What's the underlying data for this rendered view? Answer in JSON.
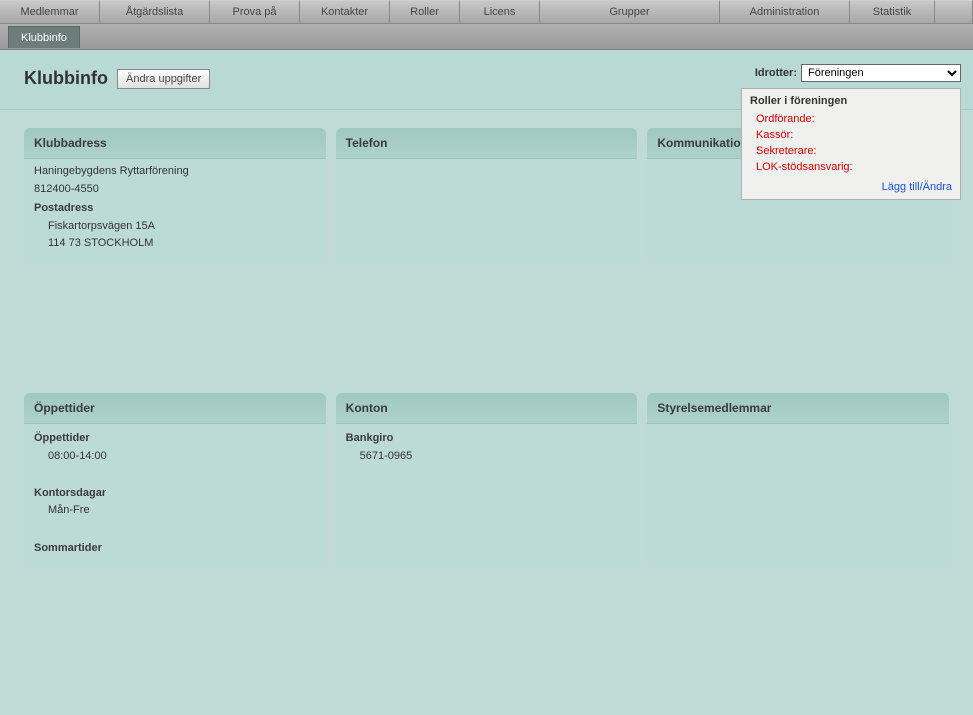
{
  "topnav": [
    {
      "label": "Medlemmar",
      "w": 100
    },
    {
      "label": "Åtgärdslista",
      "w": 110
    },
    {
      "label": "Prova på",
      "w": 90
    },
    {
      "label": "Kontakter",
      "w": 90
    },
    {
      "label": "Roller",
      "w": 70
    },
    {
      "label": "Licens",
      "w": 80
    },
    {
      "label": "Grupper",
      "w": 180
    },
    {
      "label": "Administration",
      "w": 130
    },
    {
      "label": "Statistik",
      "w": 85
    }
  ],
  "subnav": {
    "active": "Klubbinfo"
  },
  "page": {
    "title": "Klubbinfo",
    "edit_label": "Ändra uppgifter"
  },
  "idrotter": {
    "label": "Idrotter:",
    "selected": "Föreningen"
  },
  "roles": {
    "title": "Roller i föreningen",
    "items": [
      "Ordförande:",
      "Kassör:",
      "Sekreterare:",
      "LOK-stödsansvarig:"
    ],
    "link": "Lägg till/Ändra"
  },
  "cards": {
    "klubbadress": {
      "title": "Klubbadress",
      "name": "Haningebygdens Ryttarförening",
      "orgnr": "812400-4550",
      "post_label": "Postadress",
      "post_street": "Fiskartorpsvägen 15A",
      "post_city": "114 73 STOCKHOLM"
    },
    "telefon": {
      "title": "Telefon"
    },
    "kommunikation": {
      "title": "Kommunikation"
    },
    "oppettider": {
      "title": "Öppettider",
      "hours_label": "Öppettider",
      "hours": "08:00-14:00",
      "days_label": "Kontorsdagar",
      "days": "Mån-Fre",
      "summer_label": "Sommartider"
    },
    "konton": {
      "title": "Konton",
      "bankgiro_label": "Bankgiro",
      "bankgiro": "5671-0965"
    },
    "styrelse": {
      "title": "Styrelsemedlemmar"
    }
  }
}
